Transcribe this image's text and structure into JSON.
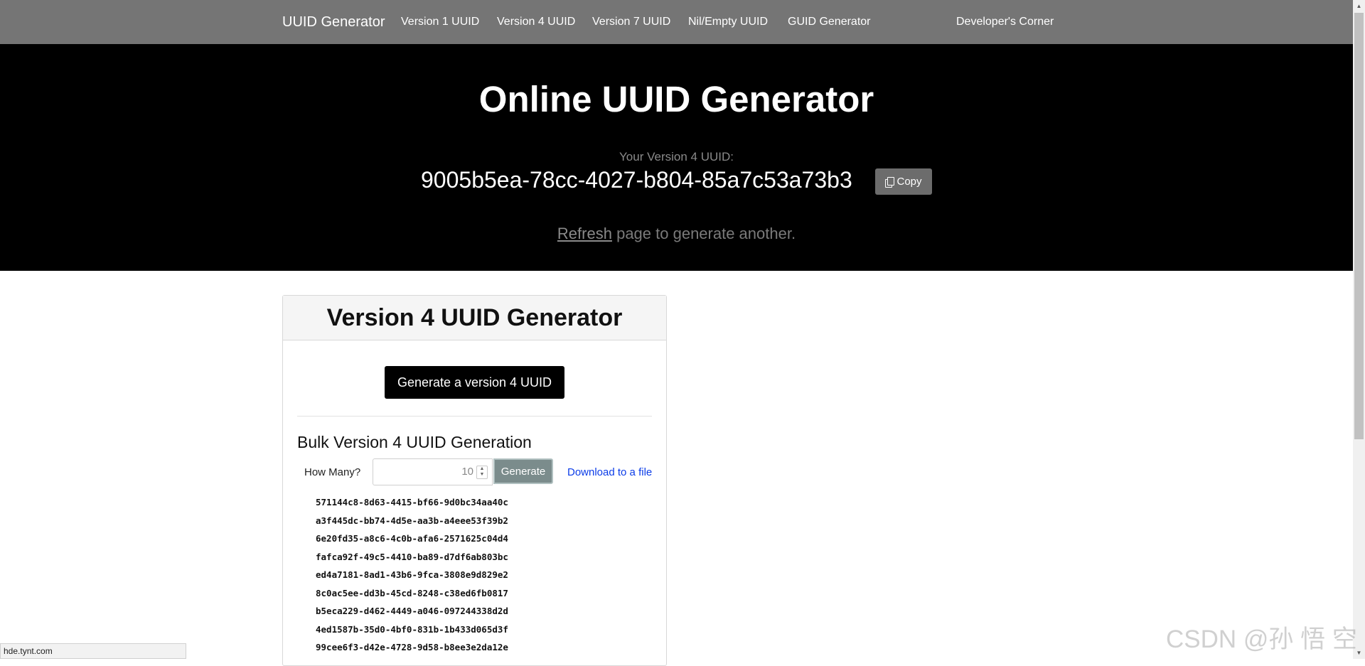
{
  "navbar": {
    "brand": "UUID Generator",
    "links": [
      "Version 1 UUID",
      "Version 4 UUID",
      "Version 7 UUID",
      "Nil/Empty UUID",
      "GUID Generator",
      "Developer's Corner"
    ]
  },
  "hero": {
    "title": "Online UUID Generator",
    "uuid_label": "Your Version 4 UUID:",
    "uuid_value": "9005b5ea-78cc-4027-b804-85a7c53a73b3",
    "copy_label": "Copy",
    "refresh_link": "Refresh",
    "refresh_suffix": " page to generate another."
  },
  "card": {
    "title": "Version 4 UUID Generator",
    "generate_button": "Generate a version 4 UUID",
    "bulk_title": "Bulk Version 4 UUID Generation",
    "how_many_label": "How Many?",
    "quantity_value": "10",
    "generate_label": "Generate",
    "download_label": "Download to a file",
    "uuids": [
      "571144c8-8d63-4415-bf66-9d0bc34aa40c",
      "a3f445dc-bb74-4d5e-aa3b-a4eee53f39b2",
      "6e20fd35-a8c6-4c0b-afa6-2571625c04d4",
      "fafca92f-49c5-4410-ba89-d7df6ab803bc",
      "ed4a7181-8ad1-43b6-9fca-3808e9d829e2",
      "8c0ac5ee-dd3b-45cd-8248-c38ed6fb0817",
      "b5eca229-d462-4449-a046-097244338d2d",
      "4ed1587b-35d0-4bf0-831b-1b433d065d3f",
      "99cee6f3-d42e-4728-9d58-b8ee3e2da12e"
    ]
  },
  "status_bar": {
    "url": "hde.tynt.com"
  },
  "watermark": "CSDN @孙 悟 空",
  "colors": {
    "navbar_bg": "#757575",
    "hero_bg": "#000000",
    "link_blue": "#0b3ce8"
  }
}
